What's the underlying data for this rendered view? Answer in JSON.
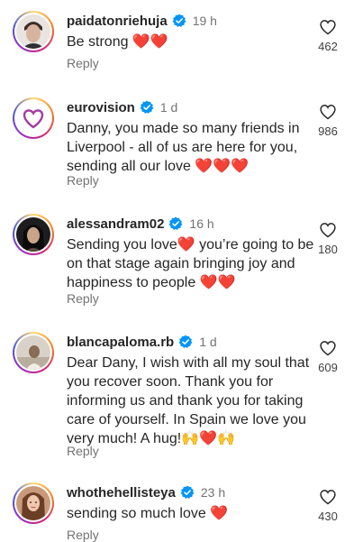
{
  "comments": [
    {
      "username": "paidatonriehuja",
      "time": "19 h",
      "text": "Be strong ❤️❤️",
      "reply": "Reply",
      "likes": "462"
    },
    {
      "username": "eurovision",
      "time": "1 d",
      "text": "Danny, you made so many friends in Liverpool - all of us are here for you, sending all our love ❤️❤️❤️",
      "reply": "Reply",
      "likes": "986"
    },
    {
      "username": "alessandram02",
      "time": "16 h",
      "text": "Sending you love❤️ you’re going to be on that stage again bringing joy and happiness to people ❤️❤️",
      "reply": "Reply",
      "likes": "180"
    },
    {
      "username": "blancapaloma.rb",
      "time": "1 d",
      "text": "Dear Dany, I wish with all my soul that you recover soon. Thank you for informing us and thank you for taking care of yourself. In Spain we love you very much! A hug!🙌❤️🙌",
      "reply": "Reply",
      "likes": "609"
    },
    {
      "username": "whothehellisteya",
      "time": "23 h",
      "text": "sending so much love ❤️",
      "reply": "Reply",
      "likes": "430"
    }
  ],
  "icons": {
    "verified": "verified-badge-icon",
    "like": "heart-outline-icon"
  },
  "colors": {
    "verified": "#0095f6",
    "text": "#262626",
    "muted": "#737373"
  }
}
